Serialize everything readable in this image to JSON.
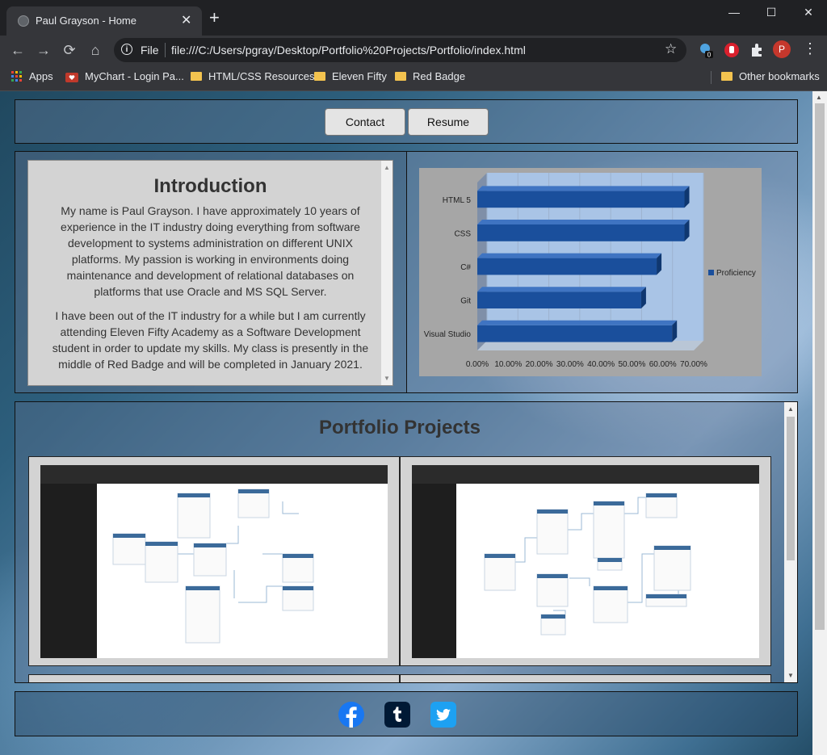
{
  "browser": {
    "tab_title": "Paul Grayson - Home",
    "new_tab": "+",
    "url_scheme": "File",
    "url": "file:///C:/Users/pgray/Desktop/Portfolio%20Projects/Portfolio/index.html",
    "extension_badge": "0",
    "profile_initial": "P",
    "bookmarks": [
      "Apps",
      "MyChart - Login Pa...",
      "HTML/CSS Resources",
      "Eleven Fifty",
      "Red Badge"
    ],
    "other_bookmarks": "Other bookmarks"
  },
  "nav": {
    "contact": "Contact",
    "resume": "Resume"
  },
  "intro": {
    "heading": "Introduction",
    "p1": "My name is Paul Grayson. I have approximately 10 years of experience in the IT industry doing everything from software development to systems administration on different UNIX platforms. My passion is working in environments doing maintenance and development of relational databases on platforms that use Oracle and MS SQL Server.",
    "p2": "I have been out of the IT industry for a while but I am currently attending Eleven Fifty Academy as a Software Development student in order to update my skills. My class is presently in the middle of Red Badge and will be completed in January 2021."
  },
  "portfolio": {
    "title": "Portfolio Projects"
  },
  "social": [
    "facebook-icon",
    "tumblr-icon",
    "twitter-icon"
  ],
  "colors": {
    "bar": "#1a4f9c",
    "plot_bg": "#a9c4e6",
    "chart_bg": "#a6a6a6"
  },
  "chart_data": {
    "type": "bar",
    "orientation": "horizontal",
    "categories": [
      "HTML 5",
      "CSS",
      "C#",
      "Git",
      "Visual Studio"
    ],
    "series": [
      {
        "name": "Proficiency",
        "values": [
          0.67,
          0.67,
          0.58,
          0.53,
          0.63
        ]
      }
    ],
    "x_ticks": [
      "0.00%",
      "10.00%",
      "20.00%",
      "30.00%",
      "40.00%",
      "50.00%",
      "60.00%",
      "70.00%"
    ],
    "xlim": [
      0,
      0.7
    ],
    "legend": "right"
  }
}
